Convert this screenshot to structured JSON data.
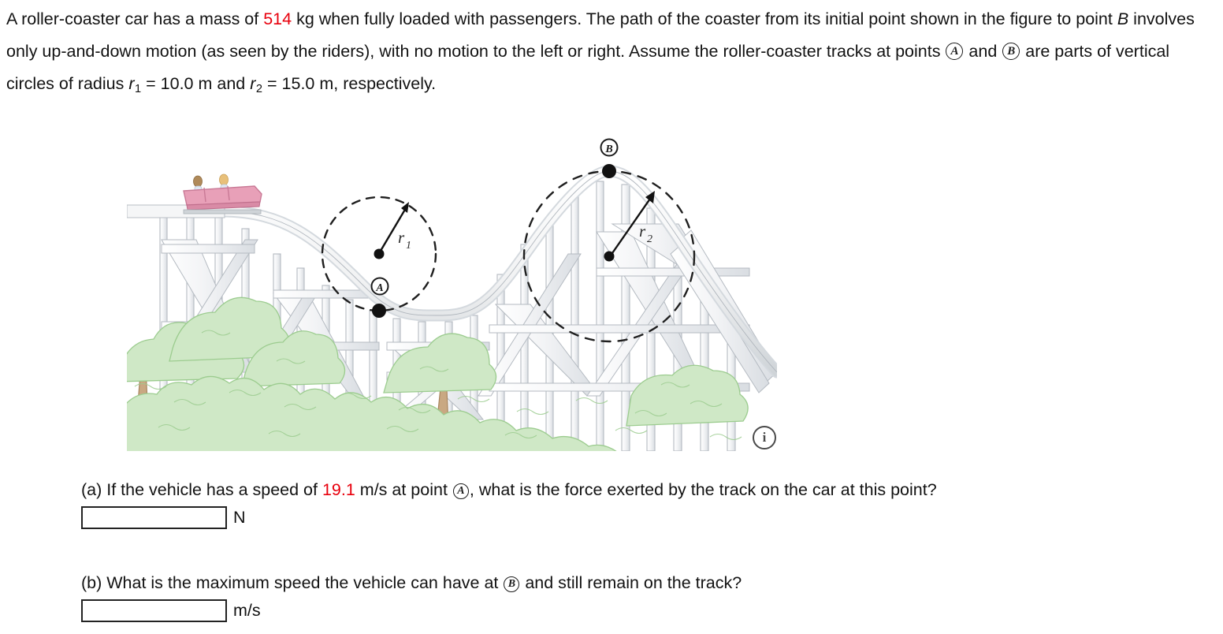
{
  "problem": {
    "line1_a": "A roller-coaster car has a mass of ",
    "mass_value": "514",
    "line1_b": " kg when fully loaded with passengers. The path of the coaster from its initial point",
    "line2_a": "shown in the figure to point ",
    "point_B_italic": "B",
    "line2_b": " involves only up-and-down motion (as seen by the riders), with no motion to the left or right.",
    "line3_a": "Assume the roller-coaster tracks at points ",
    "circled_A": "A",
    "line3_b": " and ",
    "circled_B": "B",
    "line3_c": " are parts of vertical circles of radius ",
    "r_symbol": "r",
    "r1_sub": "1",
    "r1_eq": " = 10.0 m and ",
    "r2_sub": "2",
    "r2_eq": " = 15.0 m,",
    "line4": "respectively."
  },
  "figure": {
    "label_A": "A",
    "label_B": "B",
    "radius1_label": "r",
    "radius1_sub": "1",
    "radius2_label": "r",
    "radius2_sub": "2",
    "info_icon_glyph": "i",
    "colors": {
      "track_fill": "#f0f0f0",
      "track_edge": "#9aa0a6",
      "beam_fill": "#f4f4f6",
      "beam_edge": "#a8aeb6",
      "foliage_fill": "#cfe8c6",
      "foliage_edge": "#9ccc8f",
      "trunk_fill": "#c9a882",
      "trunk_edge": "#a8855f",
      "car_fill": "#e8a0b8",
      "car_edge": "#c97a96",
      "marker": "#111111",
      "dashed_circle": "#1f1f1f"
    }
  },
  "questions": [
    {
      "id": "a",
      "prefix": "(a) If the vehicle has a speed of ",
      "speed_value": "19.1",
      "middle": " m/s at point ",
      "point": "A",
      "suffix": ", what is the force exerted by the track on the car at this point?",
      "input_value": "",
      "input_placeholder": "",
      "unit": "N"
    },
    {
      "id": "b",
      "prefix": "(b) What is the maximum speed the vehicle can have at ",
      "speed_value": "",
      "middle": "",
      "point": "B",
      "suffix": " and still remain on the track?",
      "input_value": "",
      "input_placeholder": "",
      "unit": "m/s"
    }
  ]
}
